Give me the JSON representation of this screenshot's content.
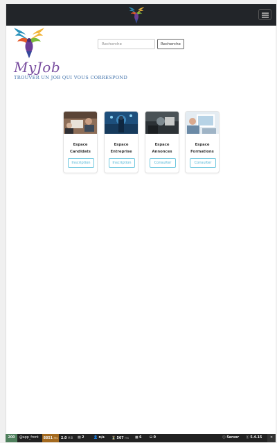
{
  "navbar": {
    "logo_icon": "phoenix-logo-icon",
    "toggle_icon": "hamburger-menu-icon"
  },
  "brand": {
    "logo_icon": "phoenix-logo-icon",
    "name": "MyJob",
    "tagline": "TROUVER UN JOB QUI VOUS CORRESPOND"
  },
  "search": {
    "placeholder": "Recherche",
    "button_label": "Recherche"
  },
  "cards": [
    {
      "title_line1": "Espace",
      "title_line2": "Candidats",
      "button_label": "Inscription"
    },
    {
      "title_line1": "Espace",
      "title_line2": "Entreprise",
      "button_label": "Inscription"
    },
    {
      "title_line1": "Espace",
      "title_line2": "Annonces",
      "button_label": "Consulter"
    },
    {
      "title_line1": "Espace",
      "title_line2": "Formations",
      "button_label": "Consulter"
    }
  ],
  "debug_toolbar": {
    "status_code": "200",
    "route": "@app_front",
    "time": "8851",
    "time_unit": "ms",
    "memory": "2.0",
    "memory_unit": "MiB",
    "forms": "2",
    "user": "n/a",
    "perf": "567",
    "perf_unit": "ms",
    "cache": "6",
    "db": "0",
    "server_label": "Server",
    "version": "5.4.15",
    "colors": {
      "status": "#4f805d",
      "time": "#a46a1f"
    }
  }
}
